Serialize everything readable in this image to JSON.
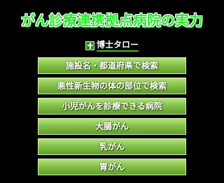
{
  "header": {
    "title": "がん診療連携拠点病院の実力"
  },
  "brand": {
    "logo_icon": "hakase-logo-icon",
    "name": "博士タロー"
  },
  "menu": {
    "items": [
      {
        "label": "施設名・都道府県で検索"
      },
      {
        "label": "悪性新生物の体の部位で検索"
      },
      {
        "label": "小児がんを診療できる病院"
      },
      {
        "label": "大腸がん"
      },
      {
        "label": "乳がん"
      },
      {
        "label": "胃がん"
      }
    ]
  },
  "colors": {
    "background": "#000000",
    "title_green": "#2ee832",
    "button_top": "#b7e27e",
    "button_bottom": "#5f9e2b"
  }
}
